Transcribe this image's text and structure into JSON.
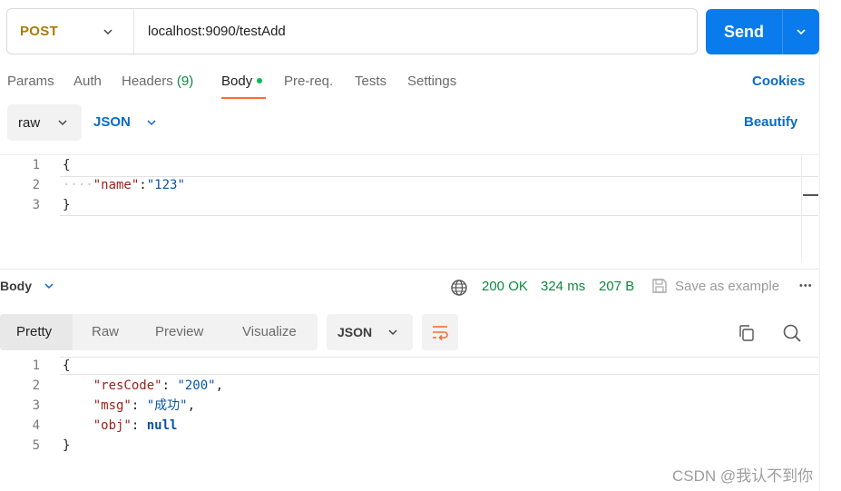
{
  "request": {
    "method": "POST",
    "url": "localhost:9090/testAdd",
    "send_label": "Send"
  },
  "tabs": [
    {
      "label": "Params"
    },
    {
      "label": "Auth"
    },
    {
      "label": "Headers",
      "count": "(9)"
    },
    {
      "label": "Body",
      "active": true
    },
    {
      "label": "Pre-req."
    },
    {
      "label": "Tests"
    },
    {
      "label": "Settings"
    }
  ],
  "cookies_label": "Cookies",
  "body_mode": "raw",
  "body_language": "JSON",
  "beautify_label": "Beautify",
  "request_body": {
    "line_numbers": [
      "1",
      "2",
      "3"
    ],
    "open_brace": "{",
    "indent_dots": "····",
    "key": "\"name\"",
    "colon": ":",
    "value": "\"123\"",
    "close_brace": "}"
  },
  "response": {
    "section_label": "Body",
    "status": "200 OK",
    "time": "324 ms",
    "size": "207 B",
    "save_example_label": "Save as example",
    "more_label": "•••",
    "views": [
      "Pretty",
      "Raw",
      "Preview",
      "Visualize"
    ],
    "format": "JSON",
    "line_numbers": [
      "1",
      "2",
      "3",
      "4",
      "5"
    ],
    "open_brace": "{",
    "close_brace": "}",
    "fields": [
      {
        "key": "\"resCode\"",
        "sep": ": ",
        "value": "\"200\"",
        "trail": ","
      },
      {
        "key": "\"msg\"",
        "sep": ": ",
        "value": "\"成功\"",
        "trail": ","
      },
      {
        "key": "\"obj\"",
        "sep": ": ",
        "value": "null",
        "trail": ""
      }
    ]
  },
  "watermark": "CSDN @我认不到你",
  "colors": {
    "accent": "#097bed",
    "method": "#ad7a03",
    "tab_underline": "#ff6c37",
    "status_ok": "#0c8a3c",
    "json_key": "#97231d",
    "json_value": "#0b53a4"
  }
}
